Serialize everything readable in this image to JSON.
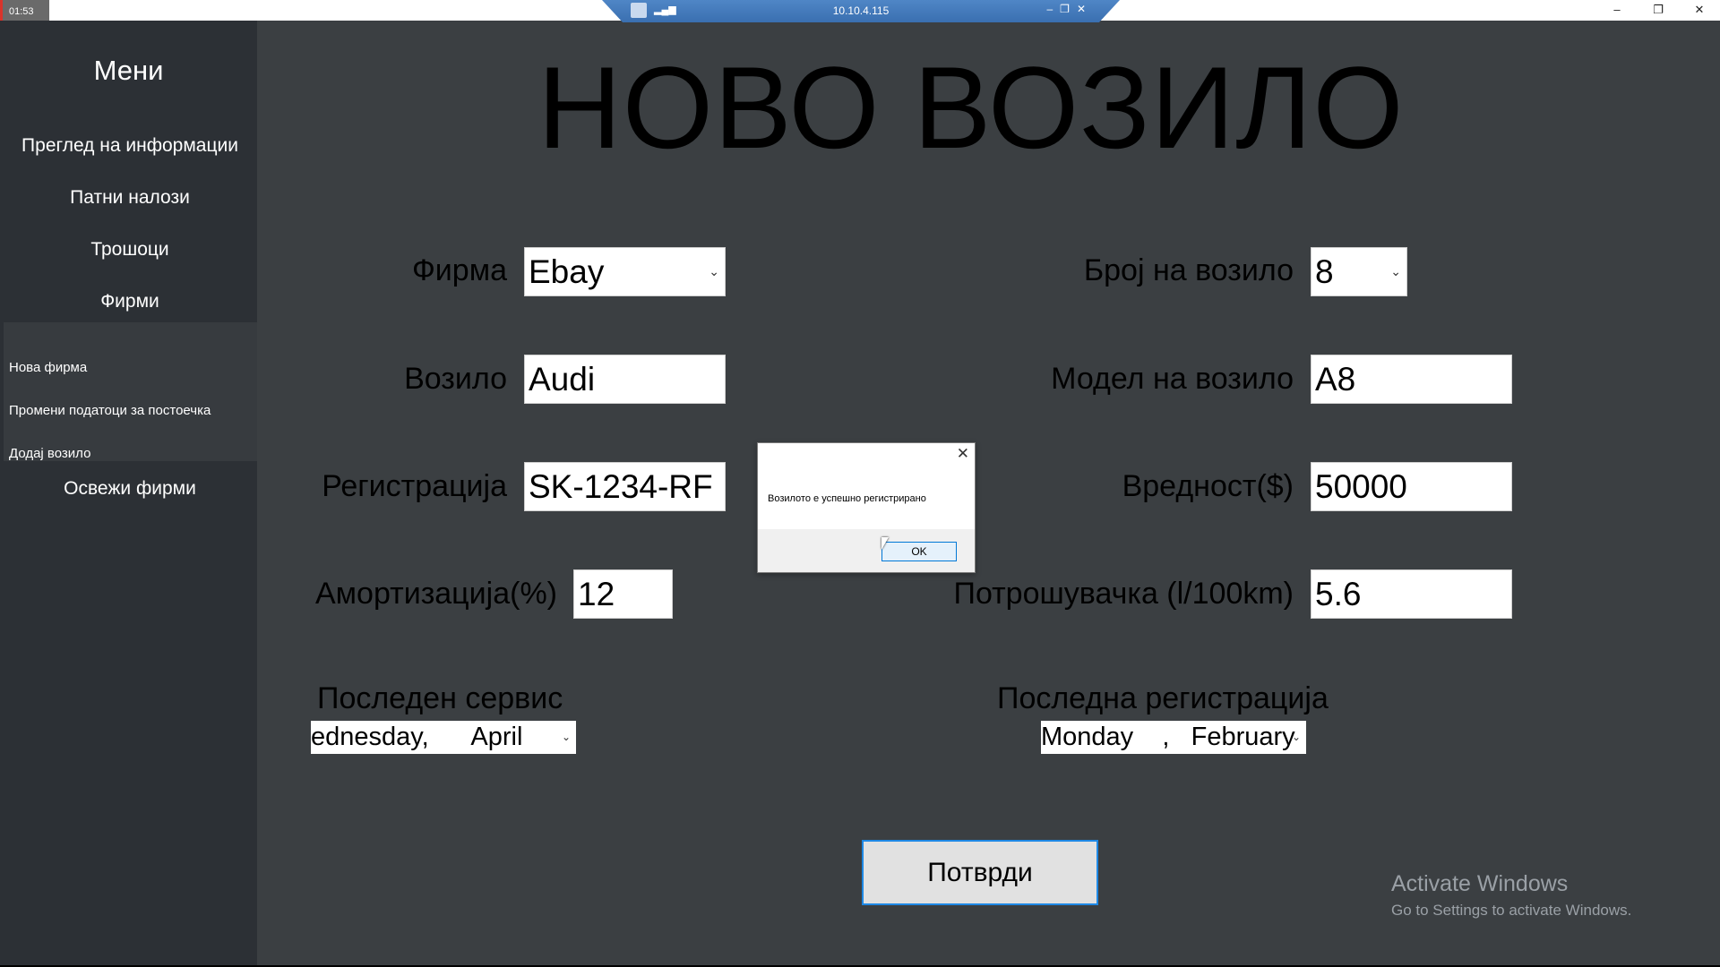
{
  "window": {
    "clock": "01:53",
    "remote_title": "10.10.4.115",
    "controls": {
      "minimize": "–",
      "restore": "❐",
      "close": "✕"
    }
  },
  "sidebar": {
    "title": "Мени",
    "items": [
      "Преглед на информации",
      "Патни налози",
      "Трошоци",
      "Фирми"
    ],
    "subitems": [
      "Нова фирма",
      "Промени податоци за постоечка",
      "Додај возило"
    ],
    "refresh": "Освежи фирми"
  },
  "main": {
    "title": "НОВО ВОЗИЛО",
    "labels": {
      "company": "Фирма",
      "vehicle": "Возило",
      "registration": "Регистрација",
      "depreciation": "Амортизација(%)",
      "vehicle_number": "Број на возило",
      "vehicle_model": "Модел на возило",
      "value": "Вредност($)",
      "consumption": "Потрошувачка (l/100km)",
      "last_service": "Последен сервис",
      "last_registration": "Последна регистрација"
    },
    "values": {
      "company": "Ebay",
      "vehicle": "Audi",
      "registration": "SK-1234-RF",
      "depreciation": "12",
      "vehicle_number": "8",
      "vehicle_model": "A8",
      "value": "50000",
      "consumption": "5.6",
      "last_service": "ednesday,      April",
      "last_registration": "Monday    ,   February"
    },
    "submit": "Потврди"
  },
  "dialog": {
    "message": "Возилото е успешно регистрирано",
    "ok": "OK",
    "close": "✕"
  },
  "watermark": {
    "line1": "Activate Windows",
    "line2": "Go to Settings to activate Windows."
  }
}
